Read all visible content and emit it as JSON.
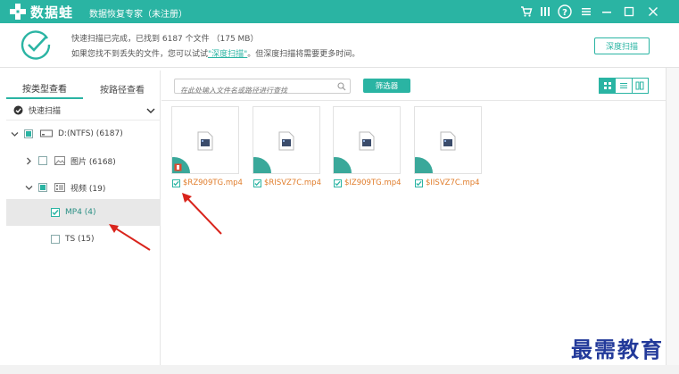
{
  "window": {
    "brand": "数据蛙",
    "subtitle": "数据恢复专家（未注册）"
  },
  "titlebar_buttons": [
    {
      "name": "cart-icon",
      "glyph": "🛒"
    },
    {
      "name": "menu-icon",
      "glyph": "≡"
    },
    {
      "name": "help-icon",
      "glyph": "?"
    },
    {
      "name": "settings-menu-icon",
      "glyph": "☰"
    },
    {
      "name": "minimize-icon",
      "glyph": "—"
    },
    {
      "name": "close-icon",
      "glyph": "✕"
    }
  ],
  "status": {
    "line1": "快速扫描已完成，已找到 6187 个文件 （175 MB）",
    "line2_before": "如果您找不到丢失的文件，您可以试试",
    "line2_link": "\"深度扫描\"",
    "line2_after": "。但深度扫描将需要更多时间。",
    "deep_scan_button": "深度扫描"
  },
  "leftpanel": {
    "tabs": [
      "按类型查看",
      "按路径查看"
    ],
    "active_tab": 0,
    "quick_scan": "快速扫描",
    "tree": [
      {
        "label": "D:(NTFS) (6187)",
        "icon": "drive-icon"
      },
      {
        "label": "图片 (6168)",
        "icon": "image-icon"
      },
      {
        "label": "视频 (19)",
        "icon": "video-icon"
      },
      {
        "label": "MP4 (4)"
      },
      {
        "label": "TS (15)"
      }
    ]
  },
  "toolbar": {
    "search_placeholder": "在此处输入文件名或路径进行查找",
    "filter_button": "筛选器"
  },
  "files": [
    {
      "name": "$RZ909TG.mp4"
    },
    {
      "name": "$RISVZ7C.mp4"
    },
    {
      "name": "$IZ909TG.mp4"
    },
    {
      "name": "$IISVZ7C.mp4"
    }
  ],
  "colors": {
    "accent": "#2ab4a3",
    "filename": "#e07c2a",
    "arrow": "#d9241c",
    "watermark": "#233a9a"
  },
  "watermark": "最需教育"
}
